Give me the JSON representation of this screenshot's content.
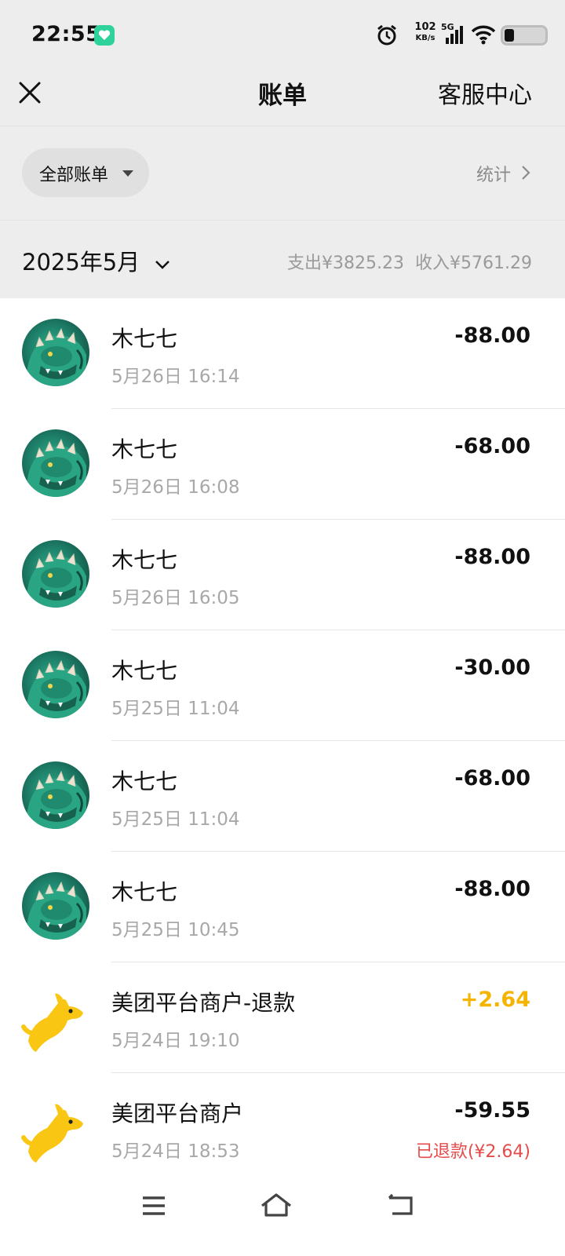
{
  "status_bar": {
    "time": "22:55",
    "net_speed_value": "102",
    "net_speed_unit": "KB/s",
    "network_type": "5G"
  },
  "header": {
    "title": "账单",
    "service_label": "客服中心"
  },
  "filter": {
    "label": "全部账单",
    "stats_label": "统计"
  },
  "month_bar": {
    "month": "2025年5月",
    "expense": "支出¥3825.23",
    "income": "收入¥5761.29"
  },
  "transactions": [
    {
      "merchant": "木七七",
      "time": "5月26日 16:14",
      "amount": "-88.00",
      "type": "expense",
      "icon": "dragon-avatar"
    },
    {
      "merchant": "木七七",
      "time": "5月26日 16:08",
      "amount": "-68.00",
      "type": "expense",
      "icon": "dragon-avatar"
    },
    {
      "merchant": "木七七",
      "time": "5月26日 16:05",
      "amount": "-88.00",
      "type": "expense",
      "icon": "dragon-avatar"
    },
    {
      "merchant": "木七七",
      "time": "5月25日 11:04",
      "amount": "-30.00",
      "type": "expense",
      "icon": "dragon-avatar"
    },
    {
      "merchant": "木七七",
      "time": "5月25日 11:04",
      "amount": "-68.00",
      "type": "expense",
      "icon": "dragon-avatar"
    },
    {
      "merchant": "木七七",
      "time": "5月25日 10:45",
      "amount": "-88.00",
      "type": "expense",
      "icon": "dragon-avatar"
    },
    {
      "merchant": "美团平台商户-退款",
      "time": "5月24日 19:10",
      "amount": "+2.64",
      "type": "income",
      "icon": "meituan-kangaroo-logo"
    },
    {
      "merchant": "美团平台商户",
      "time": "5月24日 18:53",
      "amount": "-59.55",
      "type": "expense",
      "icon": "meituan-kangaroo-logo",
      "note": "已退款(¥2.64)"
    }
  ],
  "colors": {
    "background_gray": "#ededed",
    "income_amount": "#f4b400",
    "refund_note": "#e64b4b",
    "secondary_text": "#a8a8a8"
  },
  "nav_bar": {
    "icons": [
      "menu-icon",
      "home-icon",
      "back-icon"
    ]
  }
}
